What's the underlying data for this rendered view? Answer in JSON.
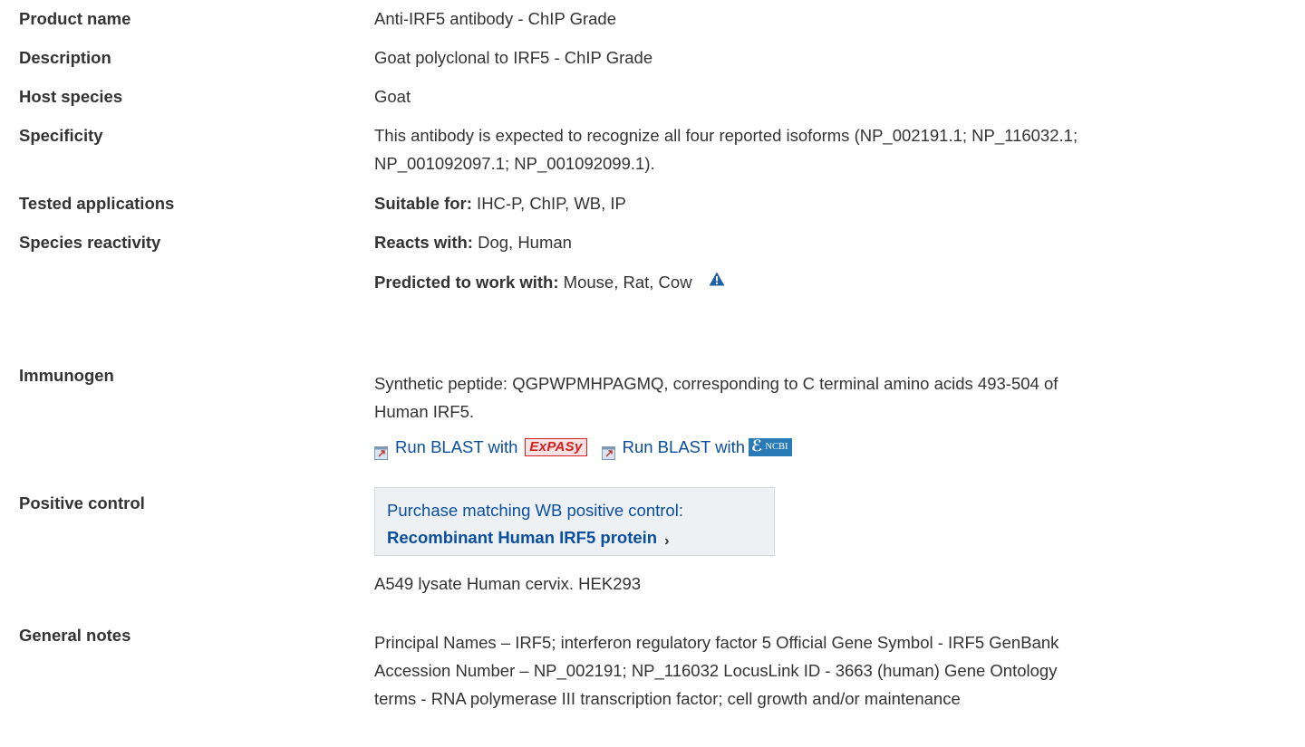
{
  "rows": {
    "product_name": {
      "label": "Product name",
      "value": "Anti-IRF5 antibody - ChIP Grade"
    },
    "description": {
      "label": "Description",
      "value": "Goat polyclonal to IRF5 - ChIP Grade"
    },
    "host_species": {
      "label": "Host species",
      "value": "Goat"
    },
    "specificity": {
      "label": "Specificity",
      "line1": "This antibody is expected to recognize all four reported isoforms (NP_002191.1; NP_116032.1;",
      "line2": "NP_001092097.1; NP_001092099.1)."
    },
    "tested_applications": {
      "label": "Tested applications",
      "prefix": "Suitable for:",
      "value": " IHC-P, ChIP, WB, IP"
    },
    "species_reactivity": {
      "label": "Species reactivity",
      "reacts_prefix": "Reacts with:",
      "reacts_value": " Dog, Human",
      "predicted_prefix": "Predicted to work with:",
      "predicted_value": " Mouse, Rat, Cow"
    },
    "immunogen": {
      "label": "Immunogen",
      "line1": "Synthetic peptide: QGPWPMHPAGMQ, corresponding to C terminal amino acids 493-504 of",
      "line2": "Human IRF5.",
      "blast1": "Run BLAST with",
      "blast1_logo": "ExPASy",
      "blast2": "Run BLAST with",
      "blast2_logo": "NCBI"
    },
    "positive_control": {
      "label": "Positive control",
      "box_line1": "Purchase matching WB positive control:",
      "box_line2": "Recombinant Human IRF5 protein",
      "value": "A549 lysate Human cervix. HEK293"
    },
    "general_notes": {
      "label": "General notes",
      "line1": "Principal Names – IRF5; interferon regulatory factor 5 Official Gene Symbol - IRF5 GenBank",
      "line2": "Accession Number – NP_002191; NP_116032 LocusLink ID - 3663 (human) Gene Ontology",
      "line3": "terms - RNA polymerase III transcription factor; cell growth and/or maintenance"
    }
  },
  "icons": {
    "warning": "warning-triangle-icon",
    "external": "external-link-icon",
    "chevron": "chevron-right-icon"
  },
  "colors": {
    "link": "#0a4ea0",
    "warning": "#1f5fa8",
    "expasy": "#d51d1d",
    "ncbi": "#2a7ab8"
  }
}
